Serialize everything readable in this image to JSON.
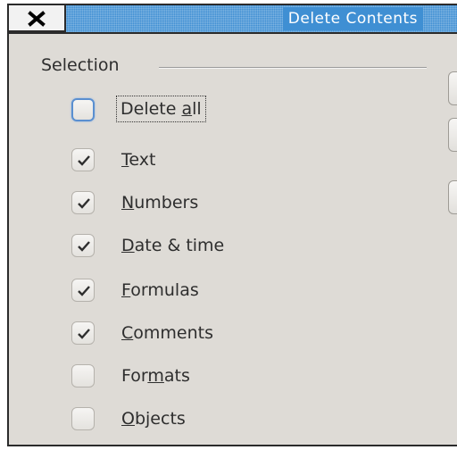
{
  "window": {
    "title": "Delete Contents",
    "close_icon": "close-icon"
  },
  "selection": {
    "heading": "Selection",
    "options": [
      {
        "pre": "Delete ",
        "ul": "a",
        "post": "ll",
        "checked": false
      },
      {
        "pre": "",
        "ul": "T",
        "post": "ext",
        "checked": true
      },
      {
        "pre": "",
        "ul": "N",
        "post": "umbers",
        "checked": true
      },
      {
        "pre": "",
        "ul": "D",
        "post": "ate & time",
        "checked": true
      },
      {
        "pre": "",
        "ul": "F",
        "post": "ormulas",
        "checked": true
      },
      {
        "pre": "",
        "ul": "C",
        "post": "omments",
        "checked": true
      },
      {
        "pre": "For",
        "ul": "m",
        "post": "ats",
        "checked": false
      },
      {
        "pre": "",
        "ul": "O",
        "post": "bjects",
        "checked": false
      }
    ]
  }
}
